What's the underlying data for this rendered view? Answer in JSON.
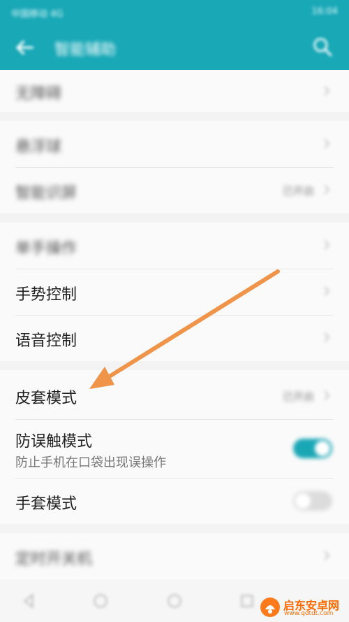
{
  "header": {
    "title": "智能辅助",
    "back_icon": "back-arrow-icon",
    "search_icon": "search-icon"
  },
  "status_bar": {
    "left_text": "中国移动 4G",
    "right_text": "16:04"
  },
  "sections": [
    {
      "items": [
        {
          "label": "无障碍"
        }
      ]
    },
    {
      "items": [
        {
          "label": "悬浮球"
        },
        {
          "label": "智能识屏",
          "value": "已开启"
        }
      ]
    },
    {
      "items": [
        {
          "label": "单手操作"
        },
        {
          "label": "手势控制"
        },
        {
          "label": "语音控制"
        }
      ]
    },
    {
      "items": [
        {
          "label": "皮套模式",
          "value": "已开启"
        },
        {
          "label": "防误触模式",
          "sublabel": "防止手机在口袋出现误操作",
          "toggle_on": true
        },
        {
          "label": "手套模式",
          "toggle_on": false
        }
      ]
    },
    {
      "items": [
        {
          "label": "定时开关机"
        }
      ]
    }
  ],
  "watermark": {
    "name": "启东安卓网",
    "url": "www.qdtdt.com"
  },
  "colors": {
    "accent": "#18a8b6",
    "arrow": "#f0944a",
    "watermark": "#ff6a00"
  }
}
